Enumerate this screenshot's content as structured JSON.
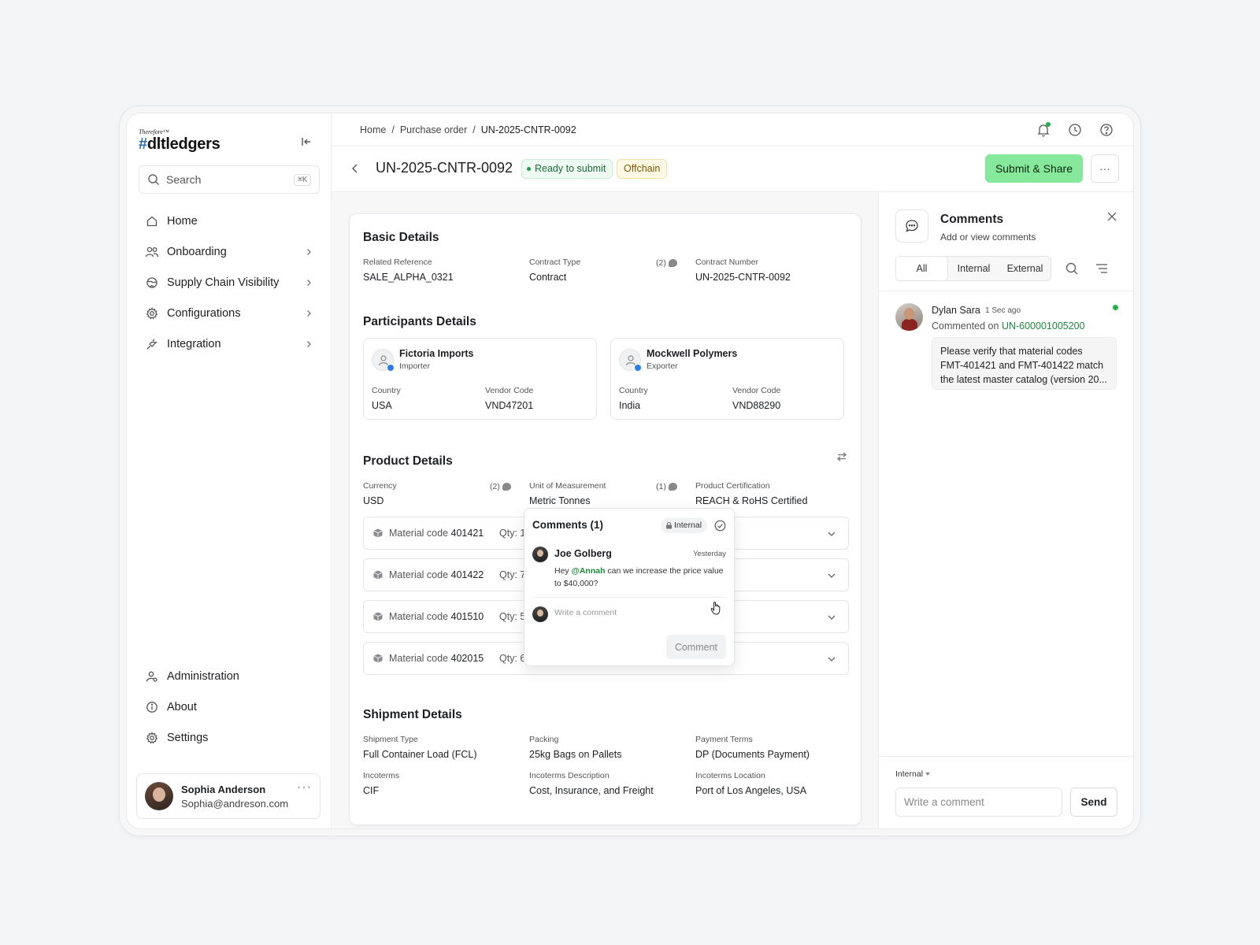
{
  "brand": {
    "tagline": "Therefore™",
    "name": "dltledgers",
    "hash": "#"
  },
  "search": {
    "label": "Search",
    "shortcut": "⌘K"
  },
  "nav": {
    "items": [
      {
        "label": "Home",
        "icon": "home-icon",
        "has_children": false
      },
      {
        "label": "Onboarding",
        "icon": "users-icon",
        "has_children": true
      },
      {
        "label": "Supply Chain Visibility",
        "icon": "globe-icon",
        "has_children": true
      },
      {
        "label": "Configurations",
        "icon": "gear-icon",
        "has_children": true
      },
      {
        "label": "Integration",
        "icon": "plug-icon",
        "has_children": true
      }
    ],
    "bottom": [
      {
        "label": "Administration",
        "icon": "admin-icon"
      },
      {
        "label": "About",
        "icon": "info-icon"
      },
      {
        "label": "Settings",
        "icon": "gear-icon"
      }
    ]
  },
  "user": {
    "name": "Sophia Anderson",
    "email": "Sophia@andreson.com"
  },
  "breadcrumb": {
    "home": "Home",
    "sep": "/",
    "section": "Purchase order",
    "current": "UN-2025-CNTR-0092"
  },
  "header": {
    "title": "UN-2025-CNTR-0092",
    "status": "Ready to submit",
    "tag": "Offchain",
    "submit_label": "Submit & Share",
    "more_label": "···"
  },
  "basic": {
    "title": "Basic Details",
    "related_reference": {
      "label": "Related Reference",
      "value": "SALE_ALPHA_0321"
    },
    "contract_type": {
      "label": "Contract Type",
      "value": "Contract",
      "comments": "(2)"
    },
    "contract_number": {
      "label": "Contract Number",
      "value": "UN-2025-CNTR-0092"
    }
  },
  "participants": {
    "title": "Participants Details",
    "items": [
      {
        "name": "Fictoria Imports",
        "role": "Importer",
        "country_label": "Country",
        "country": "USA",
        "vendor_label": "Vendor Code",
        "vendor": "VND47201"
      },
      {
        "name": "Mockwell Polymers",
        "role": "Exporter",
        "country_label": "Country",
        "country": "India",
        "vendor_label": "Vendor Code",
        "vendor": "VND88290"
      }
    ]
  },
  "product": {
    "title": "Product Details",
    "currency": {
      "label": "Currency",
      "value": "USD",
      "comments": "(2)"
    },
    "uom": {
      "label": "Unit of Measurement",
      "value": "Metric Tonnes",
      "comments": "(1)"
    },
    "certification": {
      "label": "Product Certification",
      "value": "REACH & RoHS Certified"
    },
    "materials": [
      {
        "label": "Material code",
        "code": "401421",
        "qty": "Qty: 1"
      },
      {
        "label": "Material code",
        "code": "401422",
        "qty": "Qty: 7"
      },
      {
        "label": "Material code",
        "code": "401510",
        "qty": "Qty: 5"
      },
      {
        "label": "Material code",
        "code": "402015",
        "qty": "Qty: 6"
      }
    ]
  },
  "popover": {
    "title": "Comments (1)",
    "badge": "Internal",
    "author": "Joe Golberg",
    "time": "Yesterday",
    "text_before": "Hey ",
    "mention": "@Annah",
    "text_after": " can we increase the price value to $40,000?",
    "placeholder": "Write a comment",
    "button": "Comment"
  },
  "shipment": {
    "title": "Shipment Details",
    "type": {
      "label": "Shipment Type",
      "value": "Full Container Load (FCL)"
    },
    "packing": {
      "label": "Packing",
      "value": "25kg Bags on Pallets"
    },
    "payment": {
      "label": "Payment Terms",
      "value": "DP (Documents Payment)"
    },
    "incoterms": {
      "label": "Incoterms",
      "value": "CIF"
    },
    "incoterms_desc": {
      "label": "Incoterms Description",
      "value": "Cost, Insurance, and Freight"
    },
    "incoterms_loc": {
      "label": "Incoterms Location",
      "value": "Port of Los Angeles, USA"
    }
  },
  "comments_panel": {
    "title": "Comments",
    "subtitle": "Add or view comments",
    "tabs": [
      "All",
      "Internal",
      "External"
    ],
    "active_tab": "All",
    "entry": {
      "author": "Dylan Sara",
      "time": "1 Sec ago",
      "prefix": "Commented on ",
      "link": "UN-600001005200",
      "text": "Please verify that material codes FMT-401421 and FMT-401422 match the latest master catalog (version 20..."
    },
    "visibility": "Internal",
    "input_placeholder": "Write a comment",
    "send": "Send"
  },
  "colors": {
    "accent": "#86e89a",
    "link": "#1e8a3c",
    "status_green": "#1f9a48",
    "offchain": "#fff8e5"
  }
}
